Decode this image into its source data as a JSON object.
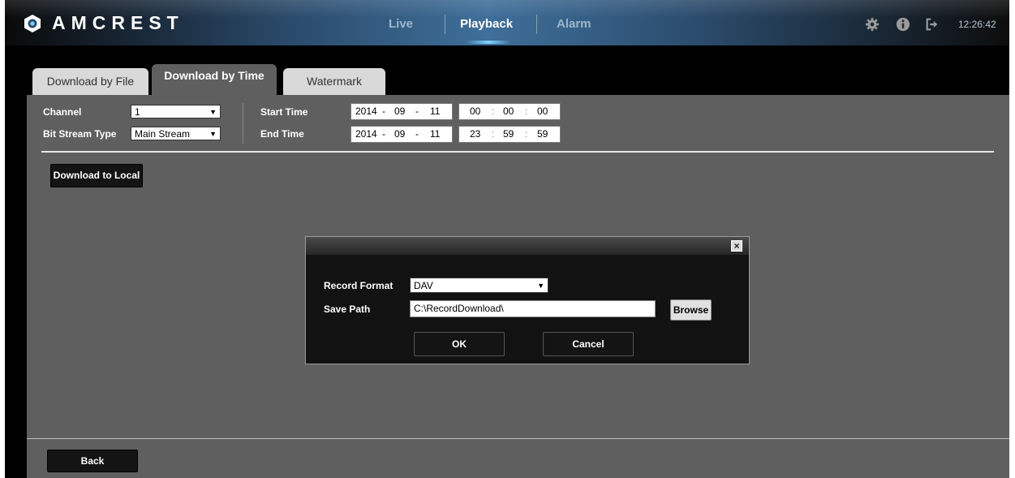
{
  "header": {
    "brand": "AMCREST",
    "nav": [
      "Live",
      "Playback",
      "Alarm"
    ],
    "active_nav": "Playback",
    "clock": "12:26:42",
    "icons": [
      "settings-gear-icon",
      "info-icon",
      "logout-icon"
    ]
  },
  "tabs": [
    "Download by File",
    "Download by Time",
    "Watermark"
  ],
  "active_tab": "Download by Time",
  "form": {
    "channel_label": "Channel",
    "channel_value": "1",
    "bitstream_label": "Bit Stream Type",
    "bitstream_value": "Main Stream",
    "start_label": "Start Time",
    "start_date": {
      "year": "2014",
      "month": "09",
      "day": "11"
    },
    "start_time": {
      "h": "00",
      "m": "00",
      "s": "00"
    },
    "end_label": "End Time",
    "end_date": {
      "year": "2014",
      "month": "09",
      "day": "11"
    },
    "end_time": {
      "h": "23",
      "m": "59",
      "s": "59"
    },
    "date_sep": "-",
    "time_sep": ":"
  },
  "download_button": "Download to Local",
  "dialog": {
    "format_label": "Record Format",
    "format_value": "DAV",
    "path_label": "Save Path",
    "path_value": "C:\\RecordDownload\\",
    "browse": "Browse",
    "ok": "OK",
    "cancel": "Cancel",
    "close": "×"
  },
  "back_button": "Back",
  "colors": {
    "accent": "#7fd0ff",
    "content_bg": "#5f5f5f",
    "dialog_bg": "#121212"
  }
}
